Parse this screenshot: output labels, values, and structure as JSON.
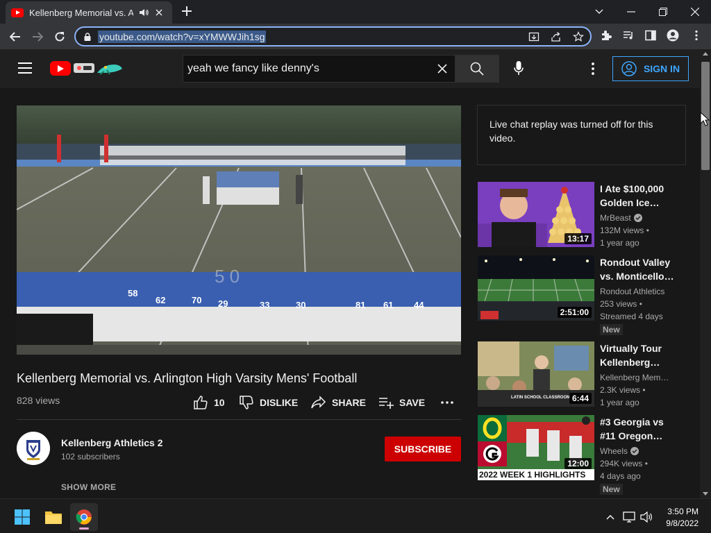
{
  "browser": {
    "tab_title": "Kellenberg Memorial vs. Arlington High Varsity Mens' Football - YouTube",
    "url": "youtube.com/watch?v=xYMWWJih1sg",
    "icons": [
      "speaker-icon",
      "close-icon",
      "plus-icon",
      "chevron-down-icon",
      "minimize-icon",
      "restore-icon",
      "back-icon",
      "forward-icon",
      "reload-icon",
      "lock-icon",
      "install-icon",
      "share-icon",
      "star-icon",
      "extensions-icon",
      "media-icon",
      "sidepanel-icon",
      "profile-icon",
      "kebab-icon"
    ]
  },
  "header": {
    "search_query": "yeah we fancy like denny's",
    "signin_label": "SIGN IN",
    "icons": [
      "menu-icon",
      "youtube-logo",
      "search-icon",
      "mic-icon",
      "more-icon",
      "account-icon"
    ]
  },
  "video": {
    "title": "Kellenberg Memorial vs. Arlington High Varsity Mens' Football",
    "views": "828 views",
    "like_count": "10",
    "dislike_label": "DISLIKE",
    "share_label": "SHARE",
    "save_label": "SAVE"
  },
  "channel": {
    "name": "Kellenberg Athletics 2",
    "subscribers": "102 subscribers",
    "subscribe_label": "SUBSCRIBE",
    "show_more_label": "SHOW MORE"
  },
  "chat": {
    "message": "Live chat replay was turned off for this video."
  },
  "recommendations": [
    {
      "title": "I Ate $100,000\nGolden Ice…",
      "channel": "MrBeast",
      "verified": true,
      "views": "132M views •",
      "age": "1 year ago",
      "duration": "13:17",
      "badge": ""
    },
    {
      "title": "Rondout Valley\nvs. Monticello…",
      "channel": "Rondout Athletics",
      "verified": false,
      "views": "253 views •",
      "age": "Streamed 4 days",
      "duration": "2:51:00",
      "badge": "New"
    },
    {
      "title": "Virtually Tour\nKellenberg…",
      "channel": "Kellenberg Mem…",
      "verified": false,
      "views": "2.3K views •",
      "age": "1 year ago",
      "duration": "6:44",
      "badge": ""
    },
    {
      "title": "#3 Georgia vs\n#11 Oregon…",
      "channel": "Wheels",
      "verified": true,
      "views": "294K views •",
      "age": "4 days ago",
      "duration": "12:00",
      "badge": "New"
    }
  ],
  "thumbnail_text": {
    "georgia": "2022 WEEK 1 HIGHLIGHTS",
    "classroom": "LATIN SCHOOL CLASSROOM"
  },
  "taskbar": {
    "time": "3:50 PM",
    "date": "9/8/2022",
    "apps": [
      "windows-start-icon",
      "file-explorer-icon",
      "chrome-icon"
    ]
  },
  "colors": {
    "accent_red": "#ff0000",
    "subscribe_red": "#cc0000",
    "link_blue": "#3ea6ff",
    "omnibox_focus": "#8ab4f8"
  }
}
